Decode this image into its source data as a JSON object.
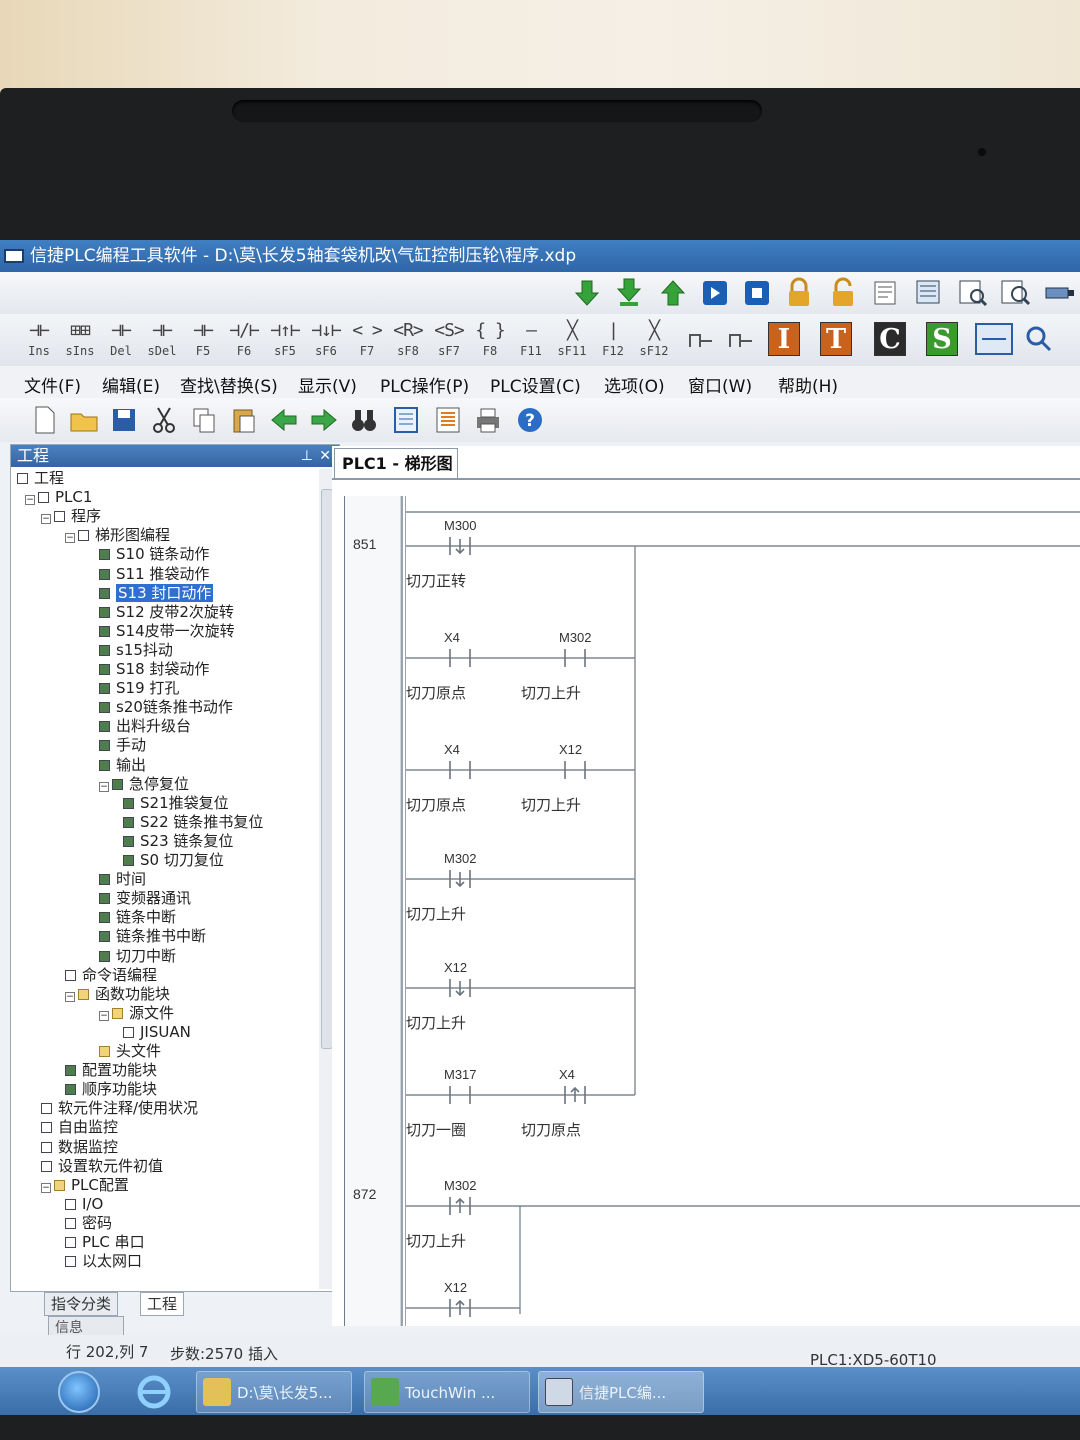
{
  "window": {
    "title": "信捷PLC编程工具软件 - D:\\莫\\长发5轴套袋机改\\气缸控制压轮\\程序.xdp"
  },
  "ladder_toolbar": [
    {
      "sym": "⊣⊢",
      "key": "Ins"
    },
    {
      "sym": "⊞⊞",
      "key": "sIns"
    },
    {
      "sym": "⊣⊢",
      "key": "Del"
    },
    {
      "sym": "⊣⊢",
      "key": "sDel"
    },
    {
      "sym": "⊣⊢",
      "key": "F5"
    },
    {
      "sym": "⊣/⊢",
      "key": "F6"
    },
    {
      "sym": "⊣↑⊢",
      "key": "sF5"
    },
    {
      "sym": "⊣↓⊢",
      "key": "sF6"
    },
    {
      "sym": "< >",
      "key": "F7"
    },
    {
      "sym": "<R>",
      "key": "sF8"
    },
    {
      "sym": "<S>",
      "key": "sF7"
    },
    {
      "sym": "{ }",
      "key": "F8"
    },
    {
      "sym": "—",
      "key": "F11"
    },
    {
      "sym": "╳",
      "key": "sF11"
    },
    {
      "sym": "|",
      "key": "F12"
    },
    {
      "sym": "╳",
      "key": "sF12"
    }
  ],
  "letter_buttons": [
    "I",
    "T",
    "C",
    "S"
  ],
  "menu": [
    "文件(F)",
    "编辑(E)",
    "查找\\替换(S)",
    "显示(V)",
    "PLC操作(P)",
    "PLC设置(C)",
    "选项(O)",
    "窗口(W)",
    "帮助(H)"
  ],
  "project_panel": {
    "title": "工程",
    "tree": [
      {
        "label": "工程",
        "level": 0,
        "icon": "project"
      },
      {
        "label": "PLC1",
        "level": 1,
        "icon": "plc",
        "expander": "−"
      },
      {
        "label": "程序",
        "level": 2,
        "icon": "page",
        "expander": "−"
      },
      {
        "label": "梯形图编程",
        "level": 3,
        "icon": "page",
        "expander": "−"
      },
      {
        "label": "S10 链条动作",
        "level": 4
      },
      {
        "label": "S11 推袋动作",
        "level": 4
      },
      {
        "label": "S13 封口动作",
        "level": 4,
        "selected": true
      },
      {
        "label": "S12 皮带2次旋转",
        "level": 4
      },
      {
        "label": "S14皮带一次旋转",
        "level": 4
      },
      {
        "label": "s15抖动",
        "level": 4
      },
      {
        "label": "S18 封袋动作",
        "level": 4
      },
      {
        "label": "S19 打孔",
        "level": 4
      },
      {
        "label": "s20链条推书动作",
        "level": 4
      },
      {
        "label": "出料升级台",
        "level": 4
      },
      {
        "label": "手动",
        "level": 4
      },
      {
        "label": "输出",
        "level": 4
      },
      {
        "label": "急停复位",
        "level": 4,
        "expander": "−"
      },
      {
        "label": "S21推袋复位",
        "level": 5
      },
      {
        "label": "S22 链条推书复位",
        "level": 5
      },
      {
        "label": "S23 链条复位",
        "level": 5
      },
      {
        "label": "S0 切刀复位",
        "level": 5
      },
      {
        "label": "时间",
        "level": 4
      },
      {
        "label": "变频器通讯",
        "level": 4
      },
      {
        "label": "链条中断",
        "level": 4
      },
      {
        "label": "链条推书中断",
        "level": 4
      },
      {
        "label": "切刀中断",
        "level": 4
      },
      {
        "label": "命令语编程",
        "level": 3,
        "icon": "page"
      },
      {
        "label": "函数功能块",
        "level": 3,
        "icon": "fold",
        "expander": "−"
      },
      {
        "label": "源文件",
        "level": 4,
        "icon": "fold",
        "expander": "−"
      },
      {
        "label": "JISUAN",
        "level": 5,
        "icon": "page"
      },
      {
        "label": "头文件",
        "level": 4,
        "icon": "fold"
      },
      {
        "label": "配置功能块",
        "level": 3
      },
      {
        "label": "顺序功能块",
        "level": 3
      },
      {
        "label": "软元件注释/使用状况",
        "level": 2,
        "icon": "page"
      },
      {
        "label": "自由监控",
        "level": 2,
        "icon": "page"
      },
      {
        "label": "数据监控",
        "level": 2,
        "icon": "page"
      },
      {
        "label": "设置软元件初值",
        "level": 2,
        "icon": "page"
      },
      {
        "label": "PLC配置",
        "level": 2,
        "icon": "fold",
        "expander": "−"
      },
      {
        "label": "I/O",
        "level": 3,
        "icon": "page"
      },
      {
        "label": "密码",
        "level": 3,
        "icon": "page"
      },
      {
        "label": "PLC 串口",
        "level": 3,
        "icon": "page"
      },
      {
        "label": "以太网口",
        "level": 3,
        "icon": "page"
      }
    ],
    "tabs": [
      "指令分类",
      "工程"
    ],
    "info_tab": "信息"
  },
  "ladder_doc": {
    "tab": "PLC1 - 梯形图",
    "row_numbers": [
      "851",
      "872"
    ],
    "contacts": [
      {
        "device": "M300",
        "comment": "切刀正转",
        "kind": "falling"
      },
      {
        "device": "X4",
        "comment": "切刀原点",
        "kind": "no"
      },
      {
        "device": "M302",
        "comment": "切刀上升",
        "kind": "no"
      },
      {
        "device": "X4",
        "comment": "切刀原点",
        "kind": "no"
      },
      {
        "device": "X12",
        "comment": "切刀上升",
        "kind": "no"
      },
      {
        "device": "M302",
        "comment": "切刀上升",
        "kind": "falling"
      },
      {
        "device": "X12",
        "comment": "切刀上升",
        "kind": "falling"
      },
      {
        "device": "M317",
        "comment": "切刀一圈",
        "kind": "no"
      },
      {
        "device": "X4",
        "comment": "切刀原点",
        "kind": "rising"
      },
      {
        "device": "M302",
        "comment": "切刀上升",
        "kind": "rising"
      },
      {
        "device": "X12",
        "comment": "",
        "kind": "rising"
      }
    ]
  },
  "status": {
    "position": "行 202,列 7",
    "steps": "步数:2570 插入",
    "plc_model": "PLC1:XD5-60T10"
  },
  "taskbar": {
    "items": [
      "D:\\莫\\长发5...",
      "TouchWin ...",
      "信捷PLC编..."
    ]
  }
}
